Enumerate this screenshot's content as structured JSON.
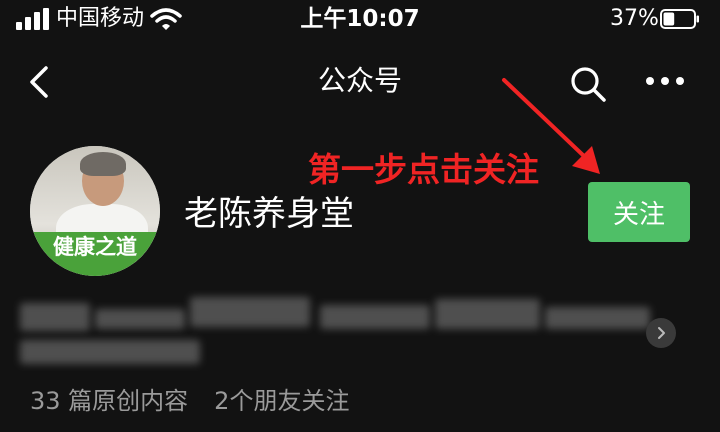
{
  "status_bar": {
    "carrier": "中国移动",
    "time": "上午10:07",
    "battery": "37%",
    "battery_level": 0.37
  },
  "nav": {
    "title": "公众号"
  },
  "annotation": {
    "text": "第一步点击关注",
    "color": "#f02424"
  },
  "profile": {
    "avatar_label": "健康之道",
    "name": "老陈养身堂",
    "follow_label": "关注",
    "follow_color": "#4fbf67"
  },
  "stats": {
    "original_count": "33 篇原创内容",
    "friends_following": "2个朋友关注"
  },
  "icons": [
    "back-arrow-icon",
    "search-icon",
    "more-icon",
    "wifi-icon",
    "signal-icon",
    "battery-icon",
    "chevron-right-icon"
  ]
}
